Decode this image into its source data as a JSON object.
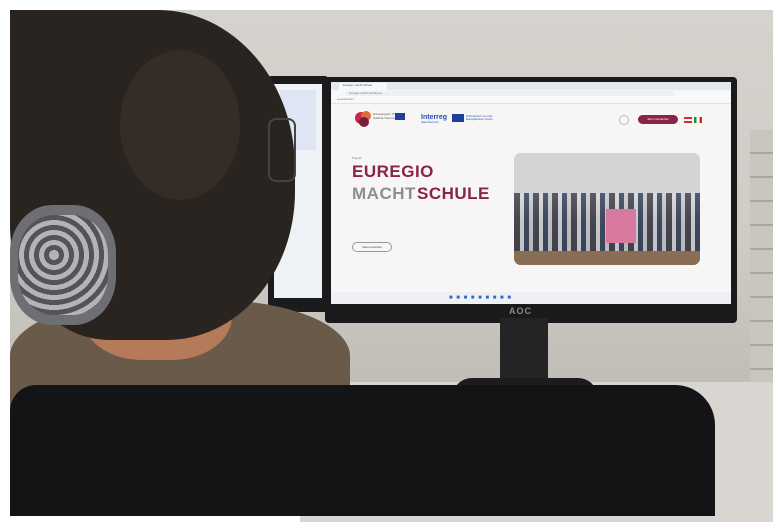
{
  "monitor": {
    "brand": "AOC"
  },
  "website": {
    "browser_tab": "Euregio macht Schule",
    "address": "euregio-macht-schule.eu",
    "bookmarks": "Lesezeichen",
    "header": {
      "logo_text": "Europaregion Tirol-Südtirol-Trentino",
      "interreg": "Interreg",
      "interreg_sub": "Italia-Österreich",
      "eu_text": "Kofinanziert von der Europäischen Union",
      "cta_label": "Jetzt mitmachen",
      "languages": [
        "AT",
        "IT"
      ]
    },
    "hero": {
      "label": "Projekt",
      "title_line1": "EUREGIO",
      "title_line2_a": "MACHT",
      "title_line2_b": "SCHULE",
      "body": "",
      "button_label": "Video ansehen"
    }
  },
  "colors": {
    "accent": "#8a2346",
    "grey_title": "#8d8f8f",
    "interreg_blue": "#2a4fb0"
  }
}
